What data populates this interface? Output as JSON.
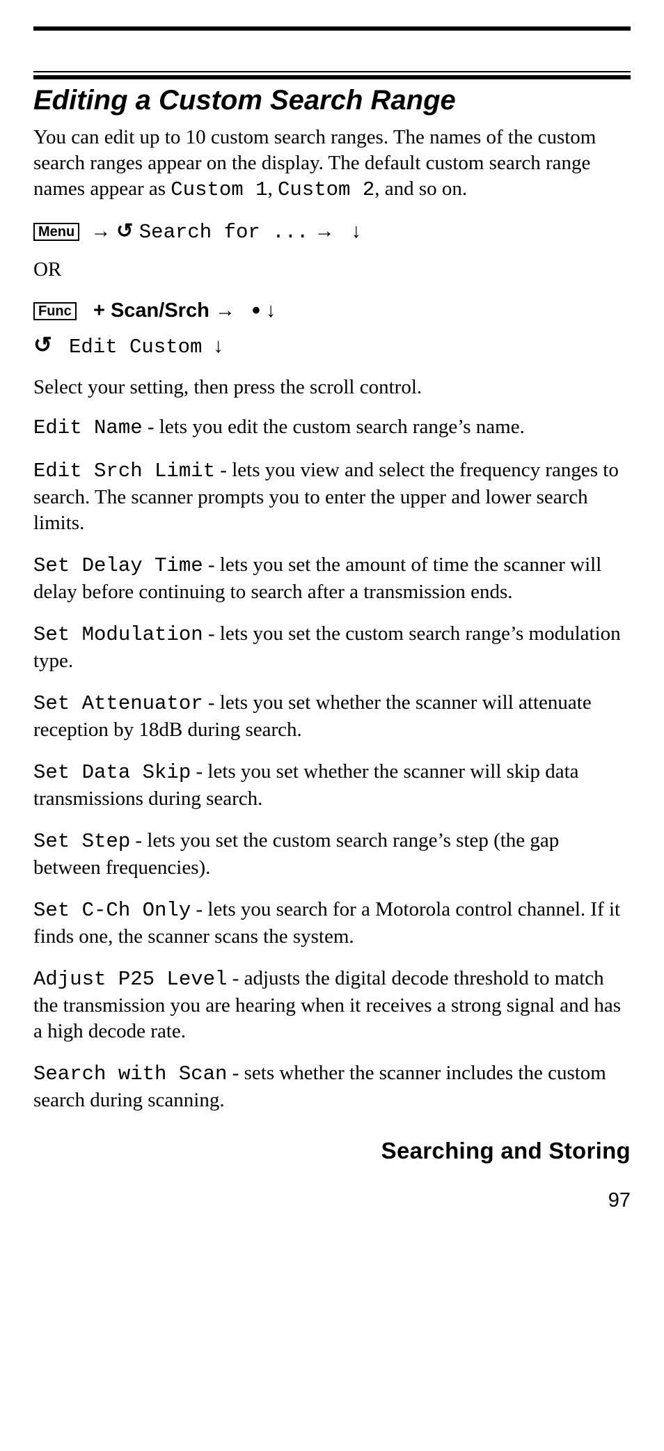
{
  "heading": "Editing a Custom Search Range",
  "intro_prefix": "You can edit up to 10 custom search ranges. The names of the custom search ranges appear on the display. The default custom search range names appear as ",
  "intro_code1": "Custom 1",
  "intro_sep": ", ",
  "intro_code2": "Custom 2",
  "intro_suffix": ", and so on.",
  "key_menu": "Menu",
  "key_func": "Func",
  "seq1_text": "Search for ...",
  "or_label": "OR",
  "seq2_scan": "Scan/Srch",
  "seq2_edit": "Edit Custom",
  "glyph_arrow_right": "→",
  "glyph_arrow_down": "↓",
  "glyph_rotate": "↻",
  "glyph_plus": "+",
  "glyph_dot": "•",
  "instruction": "Select your setting, then press the scroll control.",
  "defs": [
    {
      "term": "Edit Name",
      "desc": " - lets you edit the custom search range’s name."
    },
    {
      "term": "Edit Srch Limit",
      "desc": " - lets you view and select the frequency ranges to search. The scanner prompts you to enter the upper and lower search limits."
    },
    {
      "term": "Set Delay Time",
      "desc": " - lets you set the amount of time the scanner will delay before continuing to search after a transmission ends."
    },
    {
      "term": "Set Modulation",
      "desc": " - lets you set the custom search range’s modulation type."
    },
    {
      "term": "Set Attenuator",
      "desc": " - lets you set whether the scanner will attenuate reception by 18dB during search."
    },
    {
      "term": "Set Data Skip",
      "desc": " - lets you set whether the scanner will skip data transmissions during search."
    },
    {
      "term": "Set Step",
      "desc": " - lets you set the custom search range’s step (the gap between frequencies)."
    },
    {
      "term": "Set C-Ch Only",
      "desc": " - lets you search for a Motorola control channel. If it finds one, the scanner scans the system."
    },
    {
      "term": "Adjust P25 Level",
      "desc": " - adjusts the digital decode threshold to match the transmission you are hearing when it receives a strong signal and has a high decode rate."
    },
    {
      "term": "Search with Scan",
      "desc": " - sets whether the scanner includes the custom search during scanning."
    }
  ],
  "footer_title": "Searching and Storing",
  "page_number": "97"
}
